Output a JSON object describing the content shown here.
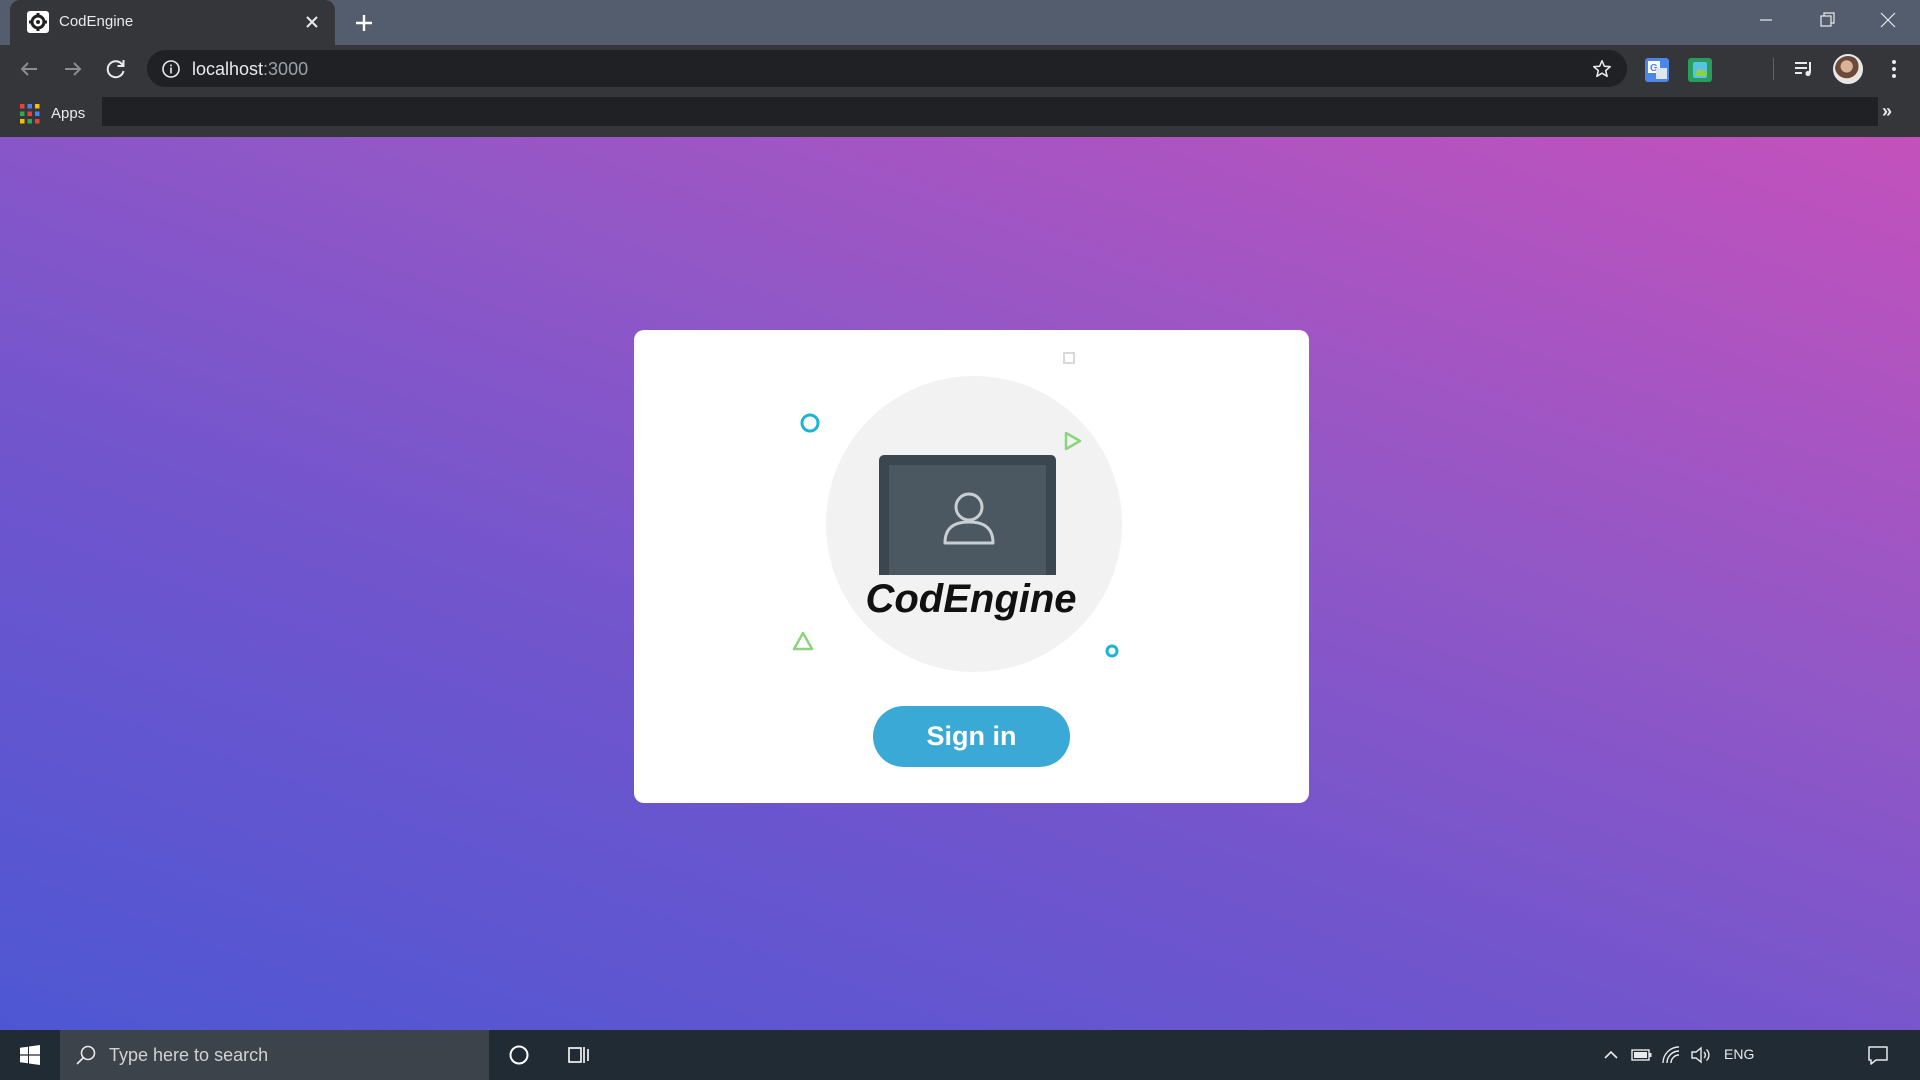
{
  "browser": {
    "tab": {
      "title": "CodEngine",
      "favicon": "gear-icon"
    },
    "address": {
      "host": "localhost",
      "port": ":3000"
    },
    "bookmarks": {
      "apps_label": "Apps",
      "more_label": "»"
    }
  },
  "page": {
    "logo_text": "CodEngine",
    "signin_label": "Sign in",
    "colors": {
      "background_start": "#4e57d3",
      "background_end": "#c451bc",
      "button": "#3aa9d6",
      "accent_cyan": "#1ab4d6",
      "accent_green": "#8cd47e"
    }
  },
  "taskbar": {
    "search_placeholder": "Type here to search",
    "language": "ENG"
  }
}
